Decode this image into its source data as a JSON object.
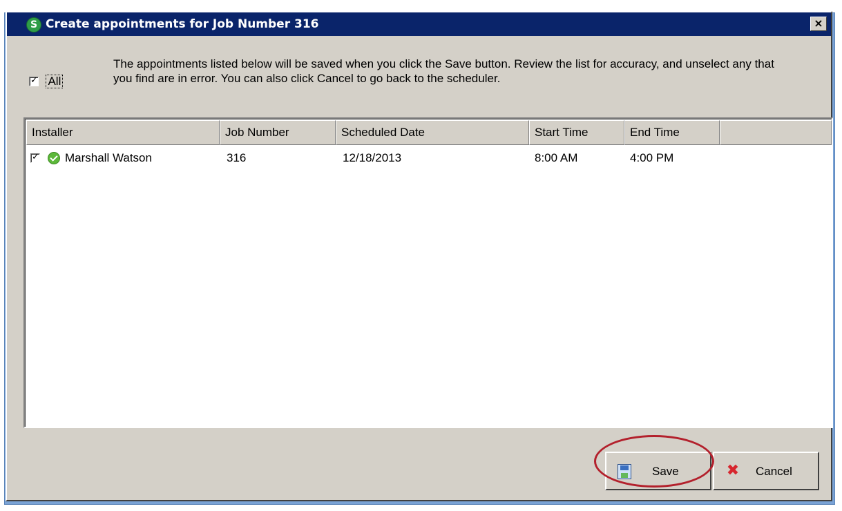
{
  "window": {
    "title": "Create appointments for Job Number 316",
    "app_icon_letter": "S",
    "close_label": "×"
  },
  "select_all": {
    "label": "All",
    "checked": true
  },
  "instructions": "The appointments listed below will be saved when you click the Save button. Review the list for accuracy, and unselect any that you find are in error. You can also click Cancel to go back to the scheduler.",
  "table": {
    "columns": [
      "Installer",
      "Job Number",
      "Scheduled Date",
      "Start Time",
      "End Time",
      ""
    ],
    "rows": [
      {
        "checked": true,
        "status_icon": "check-circle-icon",
        "installer": "Marshall Watson",
        "job_number": "316",
        "scheduled_date": "12/18/2013",
        "start_time": "8:00 AM",
        "end_time": "4:00 PM"
      }
    ]
  },
  "buttons": {
    "save_label": "Save",
    "cancel_label": "Cancel"
  },
  "colors": {
    "titlebar": "#0a246a",
    "dialog_bg": "#d4d0c8",
    "highlight_ring": "#b3202c"
  }
}
